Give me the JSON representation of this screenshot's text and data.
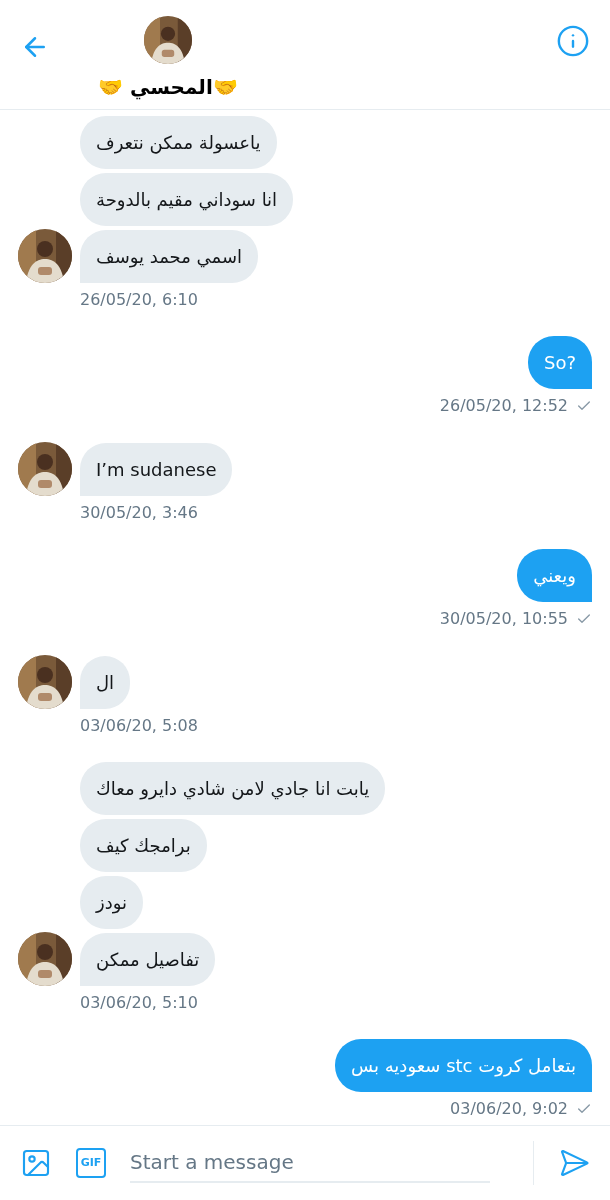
{
  "header": {
    "name": "🤝المحسي 🤝"
  },
  "messages": [
    {
      "kind": "received",
      "bubbles": [
        "ياعسولة ممكن نتعرف",
        "انا سوداني مقيم بالدوحة",
        "اسمي محمد يوسف"
      ],
      "time": "26/05/20, 6:10",
      "delivered": false
    },
    {
      "kind": "sent",
      "bubbles": [
        "So?"
      ],
      "time": "26/05/20, 12:52",
      "delivered": true
    },
    {
      "kind": "received",
      "bubbles": [
        "I’m sudanese"
      ],
      "time": "30/05/20, 3:46",
      "delivered": false
    },
    {
      "kind": "sent",
      "bubbles": [
        "ويعني"
      ],
      "time": "30/05/20, 10:55",
      "delivered": true
    },
    {
      "kind": "received",
      "bubbles": [
        "ال"
      ],
      "time": "03/06/20, 5:08",
      "delivered": false
    },
    {
      "kind": "received",
      "bubbles": [
        "يابت انا جادي لامن شادي دايرو معاك",
        "برامجك كيف",
        "نودز",
        "تفاصيل ممكن"
      ],
      "time": "03/06/20, 5:10",
      "delivered": false
    },
    {
      "kind": "sent",
      "bubbles": [
        "بتعامل كروت stc سعوديه بس"
      ],
      "time": "03/06/20, 9:02",
      "delivered": true
    }
  ],
  "composer": {
    "gif_label": "GIF",
    "placeholder": "Start a message"
  }
}
